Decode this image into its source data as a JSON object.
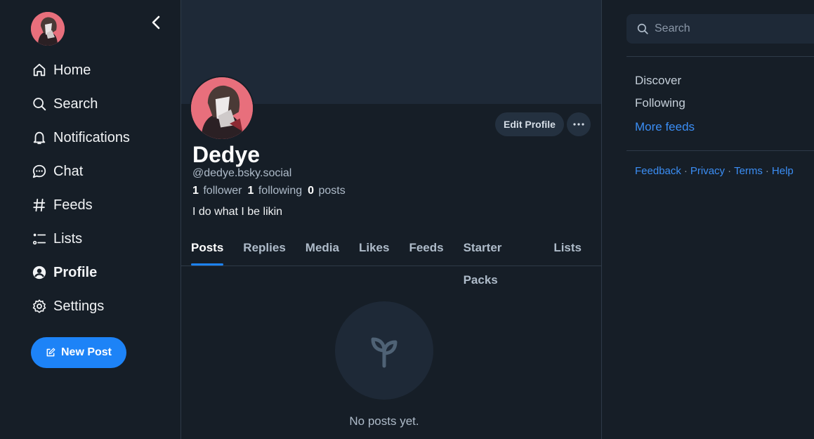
{
  "nav": {
    "items": [
      {
        "label": "Home",
        "icon": "home-icon"
      },
      {
        "label": "Search",
        "icon": "search-icon"
      },
      {
        "label": "Notifications",
        "icon": "bell-icon"
      },
      {
        "label": "Chat",
        "icon": "chat-icon"
      },
      {
        "label": "Feeds",
        "icon": "hash-icon"
      },
      {
        "label": "Lists",
        "icon": "list-icon"
      },
      {
        "label": "Profile",
        "icon": "user-circle-icon",
        "active": true
      },
      {
        "label": "Settings",
        "icon": "gear-icon"
      }
    ],
    "new_post_label": "New Post"
  },
  "profile": {
    "display_name": "Dedye",
    "handle": "@dedye.bsky.social",
    "followers_count": "1",
    "followers_label": "follower",
    "following_count": "1",
    "following_label": "following",
    "posts_count": "0",
    "posts_label": "posts",
    "bio": "I do what I be likin",
    "edit_profile_label": "Edit Profile"
  },
  "tabs": [
    "Posts",
    "Replies",
    "Media",
    "Likes",
    "Feeds",
    "Starter Packs",
    "Lists"
  ],
  "active_tab": "Posts",
  "empty_state": {
    "icon": "sprout-icon",
    "text": "No posts yet."
  },
  "sidebar": {
    "search_placeholder": "Search",
    "feeds": [
      "Discover",
      "Following"
    ],
    "more_feeds_label": "More feeds",
    "footer": [
      "Feedback",
      "Privacy",
      "Terms",
      "Help"
    ]
  },
  "colors": {
    "background": "#161e27",
    "accent": "#1d83f7",
    "link": "#3b8ef5"
  }
}
